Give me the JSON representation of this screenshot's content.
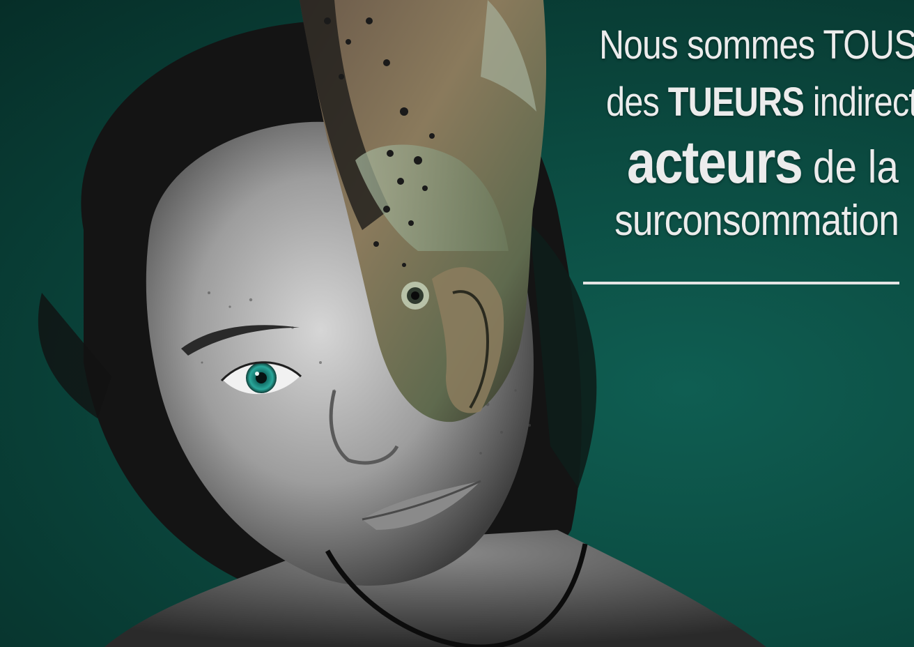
{
  "headline": {
    "line1": "Nous sommes TOUS",
    "line2_a": "des ",
    "line2_b": "TUEURS",
    "line2_c": " indirects",
    "line3_a": "acteurs",
    "line3_b": " de la",
    "line4": "surconsommation"
  },
  "colors": {
    "background": "#0b4a40",
    "text": "#ececec"
  }
}
